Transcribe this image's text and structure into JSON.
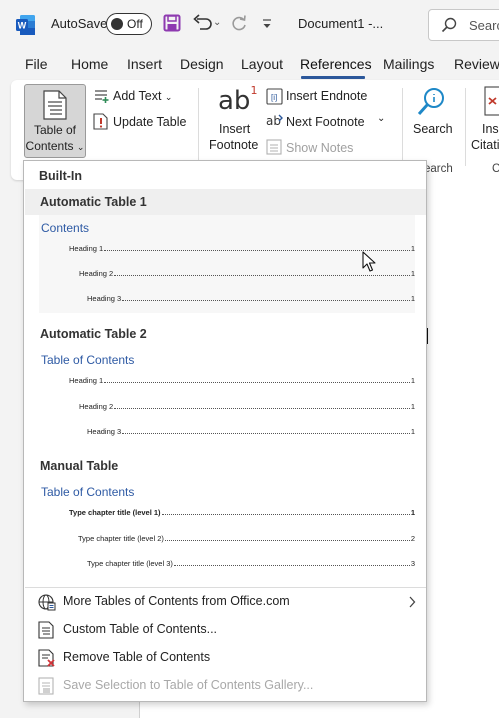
{
  "titlebar": {
    "app_icon": "word-icon",
    "autosave_label": "AutoSave",
    "autosave_state": "Off",
    "doc_title": "Document1  -...",
    "search_placeholder": "Search"
  },
  "tabs": [
    "File",
    "Home",
    "Insert",
    "Design",
    "Layout",
    "References",
    "Mailings",
    "Review"
  ],
  "active_tab": "References",
  "ribbon": {
    "toc_line1": "Table of",
    "toc_line2": "Contents",
    "add_text": "Add Text",
    "update_table": "Update Table",
    "insert_footnote_l1": "Insert",
    "insert_footnote_l2": "Footnote",
    "insert_endnote": "Insert Endnote",
    "next_footnote": "Next Footnote",
    "show_notes": "Show Notes",
    "search": "Search",
    "search_group": "earch",
    "insert_citation_l1": "Inse",
    "insert_citation_l2": "Citatio",
    "citation_group": "C"
  },
  "dropdown": {
    "built_in": "Built-In",
    "gallery": [
      {
        "heading": "Automatic Table 1",
        "title": "Contents",
        "lines": [
          {
            "text": "Heading 1",
            "page": "1"
          },
          {
            "text": "Heading 2",
            "page": "1"
          },
          {
            "text": "Heading 3",
            "page": "1"
          }
        ]
      },
      {
        "heading": "Automatic Table 2",
        "title": "Table of Contents",
        "lines": [
          {
            "text": "Heading 1",
            "page": "1"
          },
          {
            "text": "Heading 2",
            "page": "1"
          },
          {
            "text": "Heading 3",
            "page": "1"
          }
        ]
      },
      {
        "heading": "Manual Table",
        "title": "Table of Contents",
        "lines": [
          {
            "text": "Type chapter title (level 1)",
            "page": "1"
          },
          {
            "text": "Type chapter title (level 2)",
            "page": "2"
          },
          {
            "text": "Type chapter title (level 3)",
            "page": "3"
          }
        ]
      }
    ],
    "menu_items": [
      {
        "label": "More Tables of Contents from Office.com",
        "icon": "globe-icon",
        "submenu": true,
        "enabled": true
      },
      {
        "label": "Custom Table of Contents...",
        "icon": "custom-toc-icon",
        "submenu": false,
        "enabled": true
      },
      {
        "label": "Remove Table of Contents",
        "icon": "remove-toc-icon",
        "submenu": false,
        "enabled": true
      },
      {
        "label": "Save Selection to Table of Contents Gallery...",
        "icon": "save-gallery-icon",
        "submenu": false,
        "enabled": false
      }
    ]
  },
  "colors": {
    "accent": "#2b579a",
    "toc_title_blue": "#2e5aa4",
    "word_blue": "#185abd",
    "save_purple": "#8e3ab0"
  }
}
